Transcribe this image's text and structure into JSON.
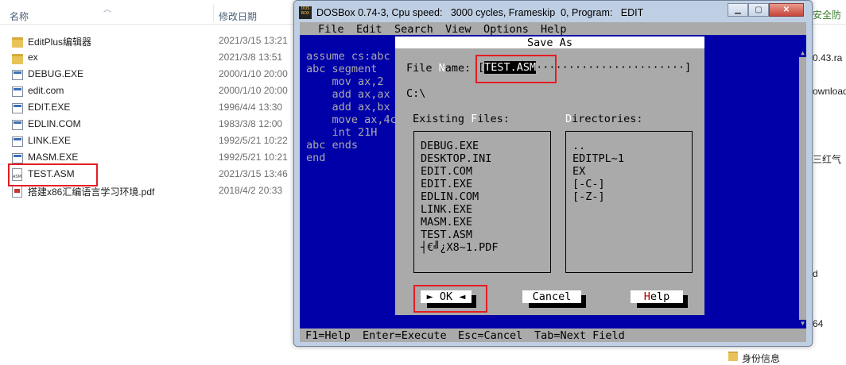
{
  "explorer": {
    "col_name": "名称",
    "col_date": "修改日期",
    "files": [
      {
        "icon": "folder-icon",
        "name": "EditPlus编辑器",
        "date": "2021/3/15 13:21"
      },
      {
        "icon": "folder-icon",
        "name": "ex",
        "date": "2021/3/8 13:51"
      },
      {
        "icon": "exe-icon",
        "name": "DEBUG.EXE",
        "date": "2000/1/10 20:00"
      },
      {
        "icon": "exe-icon",
        "name": "edit.com",
        "date": "2000/1/10 20:00"
      },
      {
        "icon": "exe-icon",
        "name": "EDIT.EXE",
        "date": "1996/4/4 13:30"
      },
      {
        "icon": "exe-icon",
        "name": "EDLIN.COM",
        "date": "1983/3/8 12:00"
      },
      {
        "icon": "exe-icon",
        "name": "LINK.EXE",
        "date": "1992/5/21 10:22"
      },
      {
        "icon": "exe-icon",
        "name": "MASM.EXE",
        "date": "1992/5/21 10:21"
      },
      {
        "icon": "asm-file-icon",
        "name": "TEST.ASM",
        "date": "2021/3/15 13:46"
      },
      {
        "icon": "pdf-file-icon",
        "name": "搭建x86汇编语言学习环境.pdf",
        "date": "2018/4/2 20:33"
      }
    ],
    "asm_icon_label": "ASM",
    "right_fragments": [
      "安全防",
      "0.43.ra",
      "ownload",
      "三红气",
      "d",
      "64",
      "身份信息"
    ]
  },
  "dosbox": {
    "logo_text": "DOS BOX",
    "title": "DOSBox 0.74-3, Cpu speed:   3000 cycles, Frameskip  0, Program:   EDIT",
    "menu": [
      "File",
      "Edit",
      "Search",
      "View",
      "Options",
      "Help"
    ],
    "editor_lines": [
      "assume cs:abc",
      "abc segment",
      "    mov ax,2",
      "    add ax,ax",
      "    add ax,bx",
      "    move ax,4c",
      "    int 21H",
      "abc ends",
      "end"
    ],
    "status": [
      "F1=Help",
      "Enter=Execute",
      "Esc=Cancel",
      "Tab=Next Field"
    ],
    "dialog": {
      "title": "Save As",
      "filename_label_pre": "File ",
      "filename_label_hot": "N",
      "filename_label_post": "ame:",
      "filename_value": "TEST.ASM",
      "filename_dots": "·······················]",
      "filename_bracket": "[",
      "current_path": "C:\\",
      "existing_label_pre": "Existing ",
      "existing_label_hot": "F",
      "existing_label_post": "iles:",
      "dirs_label_hot": "D",
      "dirs_label_post": "irectories:",
      "existing_files": [
        "DEBUG.EXE",
        "DESKTOP.INI",
        "EDIT.COM",
        "EDIT.EXE",
        "EDLIN.COM",
        "LINK.EXE",
        "MASM.EXE",
        "TEST.ASM",
        "┤€╝¿X8~1.PDF"
      ],
      "directories": [
        "..",
        "EDITPL~1",
        "EX",
        "[-C-]",
        "[-Z-]"
      ],
      "ok_label": "OK",
      "cancel_label": "Cancel",
      "help_label_hot": "H",
      "help_label_post": "elp"
    }
  },
  "colors": {
    "dos_blue": "#0000a8",
    "dos_gray": "#aaaaaa",
    "highlight_red": "#e51c23"
  }
}
